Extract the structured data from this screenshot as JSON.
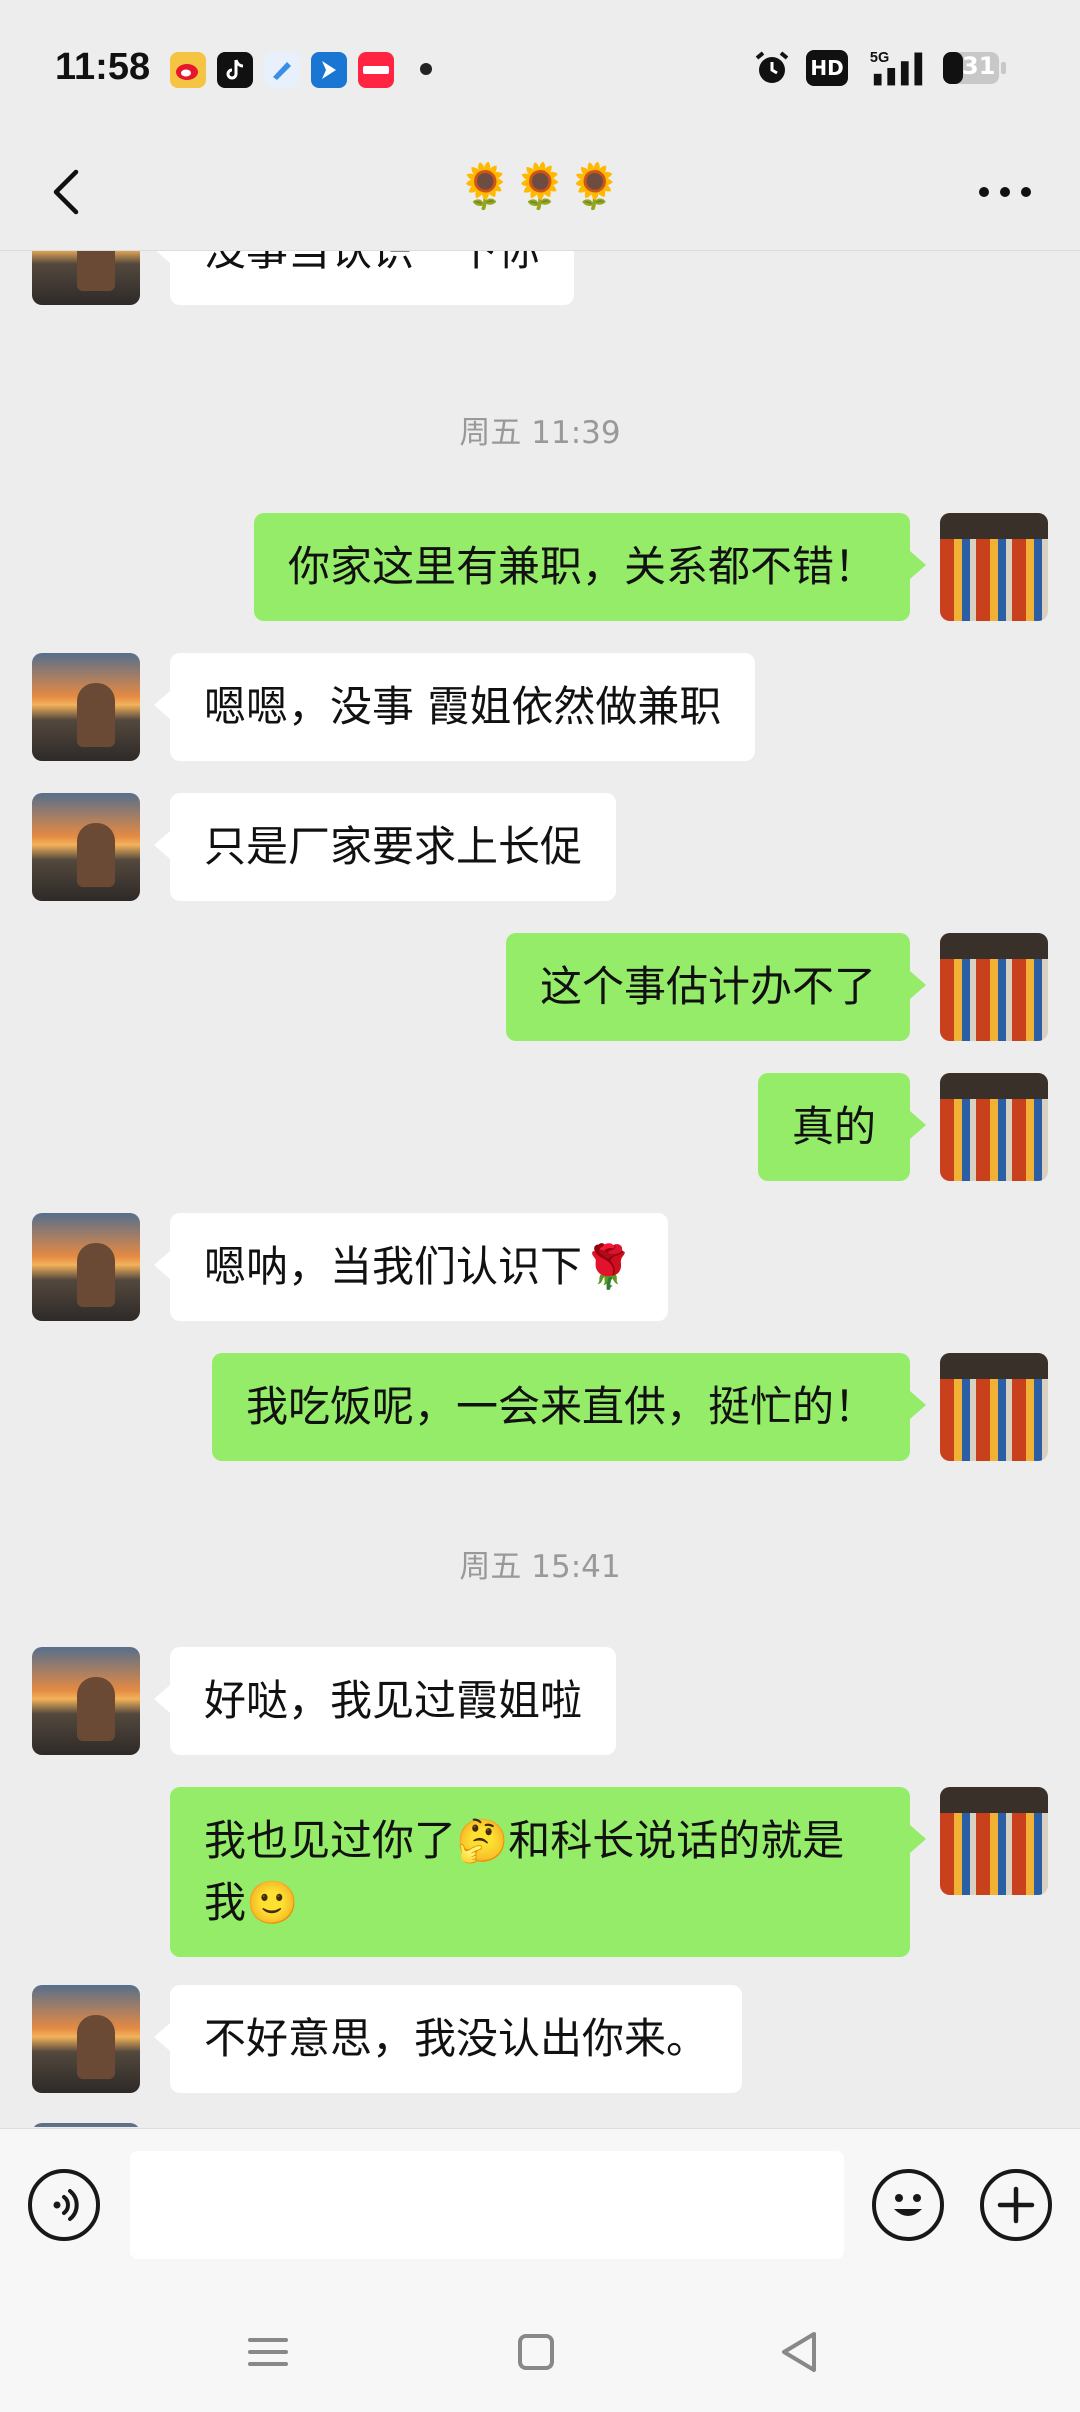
{
  "status_bar": {
    "time": "11:58",
    "network": "5G",
    "hd_label": "HD",
    "battery": "31"
  },
  "header": {
    "title": "🌻🌻🌻"
  },
  "messages": [
    {
      "side": "in",
      "text": "没事当认识一下你"
    },
    {
      "type": "time",
      "text": "周五 11:39"
    },
    {
      "side": "out",
      "text": "你家这里有兼职，关系都不错！"
    },
    {
      "side": "in",
      "text": "嗯嗯，没事 霞姐依然做兼职"
    },
    {
      "side": "in",
      "text": "只是厂家要求上长促"
    },
    {
      "side": "out",
      "text": "这个事估计办不了"
    },
    {
      "side": "out",
      "text": "真的"
    },
    {
      "side": "in",
      "text": "嗯呐，当我们认识下🌹"
    },
    {
      "side": "out",
      "text": "我吃饭呢，一会来直供，挺忙的！"
    },
    {
      "type": "time",
      "text": "周五 15:41"
    },
    {
      "side": "in",
      "text": "好哒，我见过霞姐啦"
    },
    {
      "side": "out",
      "text": "我也见过你了🤔和科长说话的就是我🙂"
    },
    {
      "side": "in",
      "text": "不好意思，我没认出你来。"
    }
  ],
  "input": {
    "value": "",
    "placeholder": ""
  },
  "colors": {
    "outgoing_bubble": "#95ec69",
    "incoming_bubble": "#ffffff",
    "background": "#ededed"
  },
  "icons": {
    "back": "chevron-left-icon",
    "more": "more-dots-icon",
    "voice": "voice-icon",
    "emoji": "emoji-icon",
    "plus": "plus-icon"
  }
}
